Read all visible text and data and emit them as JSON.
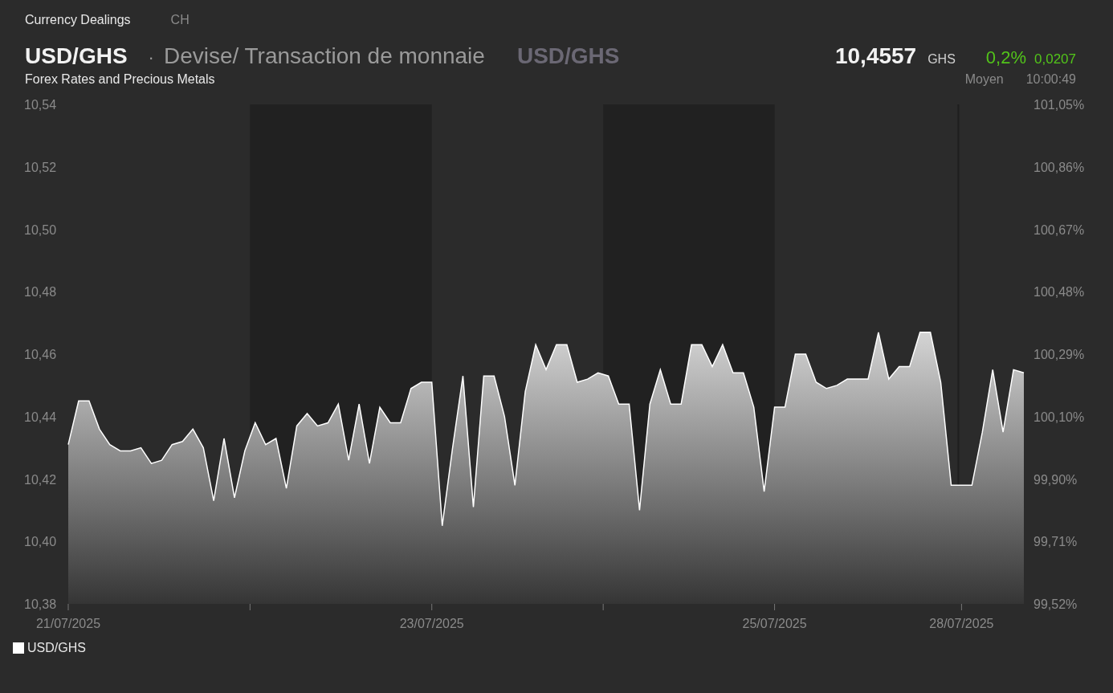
{
  "breadcrumb": {
    "section": "Currency Dealings",
    "region": "CH"
  },
  "header": {
    "symbol": "USD/GHS",
    "separator": "·",
    "category": "Devise/ Transaction de monnaie",
    "symbol_secondary": "USD/GHS",
    "subtitle": "Forex Rates and Precious Metals",
    "price": "10,4557",
    "currency": "GHS",
    "change_percent": "0,2%",
    "change_absolute": "0,0207",
    "rising": true,
    "price_type": "Moyen",
    "time": "10:00:49"
  },
  "chart": {
    "right_axis_labels": [
      "101,05%",
      "100,86%",
      "100,67%",
      "100,48%",
      "100,29%",
      "100,10%",
      "99,90%",
      "99,71%",
      "99,52%"
    ],
    "chart_data": {
      "type": "area",
      "ylim": [
        10.38,
        10.54
      ],
      "yticks": [
        {
          "value": 10.38,
          "label": "10,38"
        },
        {
          "value": 10.4,
          "label": "10,40"
        },
        {
          "value": 10.42,
          "label": "10,42"
        },
        {
          "value": 10.44,
          "label": "10,44"
        },
        {
          "value": 10.46,
          "label": "10,46"
        },
        {
          "value": 10.48,
          "label": "10,48"
        },
        {
          "value": 10.5,
          "label": "10,50"
        },
        {
          "value": 10.52,
          "label": "10,52"
        },
        {
          "value": 10.54,
          "label": "10,54"
        }
      ],
      "categories": [
        "21/07/2025",
        null,
        null,
        null,
        null,
        null,
        null,
        null,
        null,
        null,
        null,
        null,
        null,
        null,
        null,
        null,
        null,
        null,
        null,
        null,
        null,
        null,
        null,
        null,
        null,
        null,
        null,
        null,
        null,
        null,
        null,
        null,
        null,
        null,
        null,
        "23/07/2025",
        null,
        null,
        null,
        null,
        null,
        null,
        null,
        null,
        null,
        null,
        null,
        null,
        null,
        null,
        null,
        null,
        null,
        null,
        null,
        null,
        null,
        null,
        null,
        null,
        null,
        null,
        null,
        null,
        null,
        null,
        null,
        null,
        "25/07/2025",
        null,
        null,
        null,
        null,
        null,
        null,
        null,
        null,
        null,
        null,
        null,
        null,
        null,
        null,
        null,
        null,
        null,
        "28/07/2025",
        null,
        null,
        null,
        null,
        null,
        null
      ],
      "series": [
        {
          "name": "USD/GHS",
          "color": "#ffffff",
          "values": [
            10.431,
            10.445,
            10.445,
            10.436,
            10.431,
            10.429,
            10.429,
            10.43,
            10.425,
            10.426,
            10.431,
            10.432,
            10.436,
            10.43,
            10.413,
            10.433,
            10.414,
            10.429,
            10.438,
            10.431,
            10.433,
            10.417,
            10.437,
            10.441,
            10.437,
            10.438,
            10.444,
            10.426,
            10.444,
            10.425,
            10.443,
            10.438,
            10.438,
            10.449,
            10.451,
            10.451,
            10.405,
            10.43,
            10.453,
            10.411,
            10.453,
            10.453,
            10.44,
            10.418,
            10.448,
            10.463,
            10.455,
            10.463,
            10.463,
            10.451,
            10.452,
            10.454,
            10.453,
            10.444,
            10.444,
            10.41,
            10.444,
            10.455,
            10.444,
            10.444,
            10.463,
            10.463,
            10.456,
            10.463,
            10.454,
            10.454,
            10.443,
            10.416,
            10.443,
            10.443,
            10.46,
            10.46,
            10.451,
            10.449,
            10.45,
            10.452,
            10.452,
            10.452,
            10.467,
            10.452,
            10.456,
            10.456,
            10.467,
            10.467,
            10.451,
            10.418,
            10.418,
            10.418,
            10.435,
            10.455,
            10.435,
            10.455,
            10.454
          ]
        }
      ]
    }
  }
}
